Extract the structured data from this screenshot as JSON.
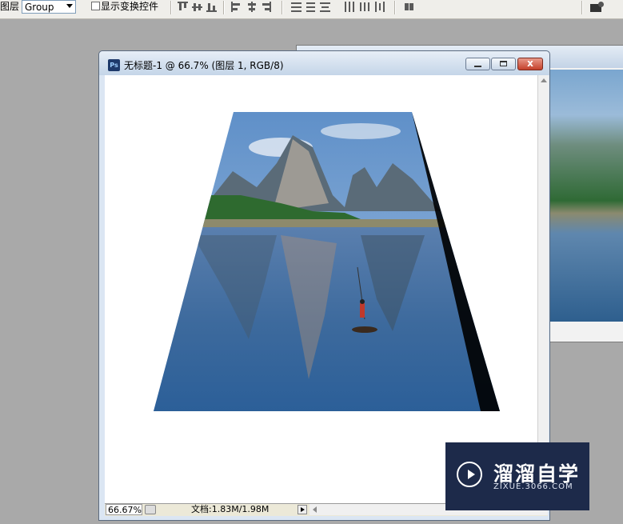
{
  "options_bar": {
    "layer_label": "图层",
    "layer_select_value": "Group",
    "show_transform_label": "显示变换控件"
  },
  "document_window": {
    "title": "无标题-1 @ 66.7% (图层 1, RGB/8)",
    "minimize_icon": "minimize-icon",
    "maximize_icon": "maximize-icon",
    "close_label": "x"
  },
  "status_bar": {
    "zoom_value": "66.67%",
    "doc_info": "文档:1.83M/1.98M"
  },
  "watermark": {
    "name": "溜溜自学",
    "url": "ZIXUE.3066.COM"
  }
}
